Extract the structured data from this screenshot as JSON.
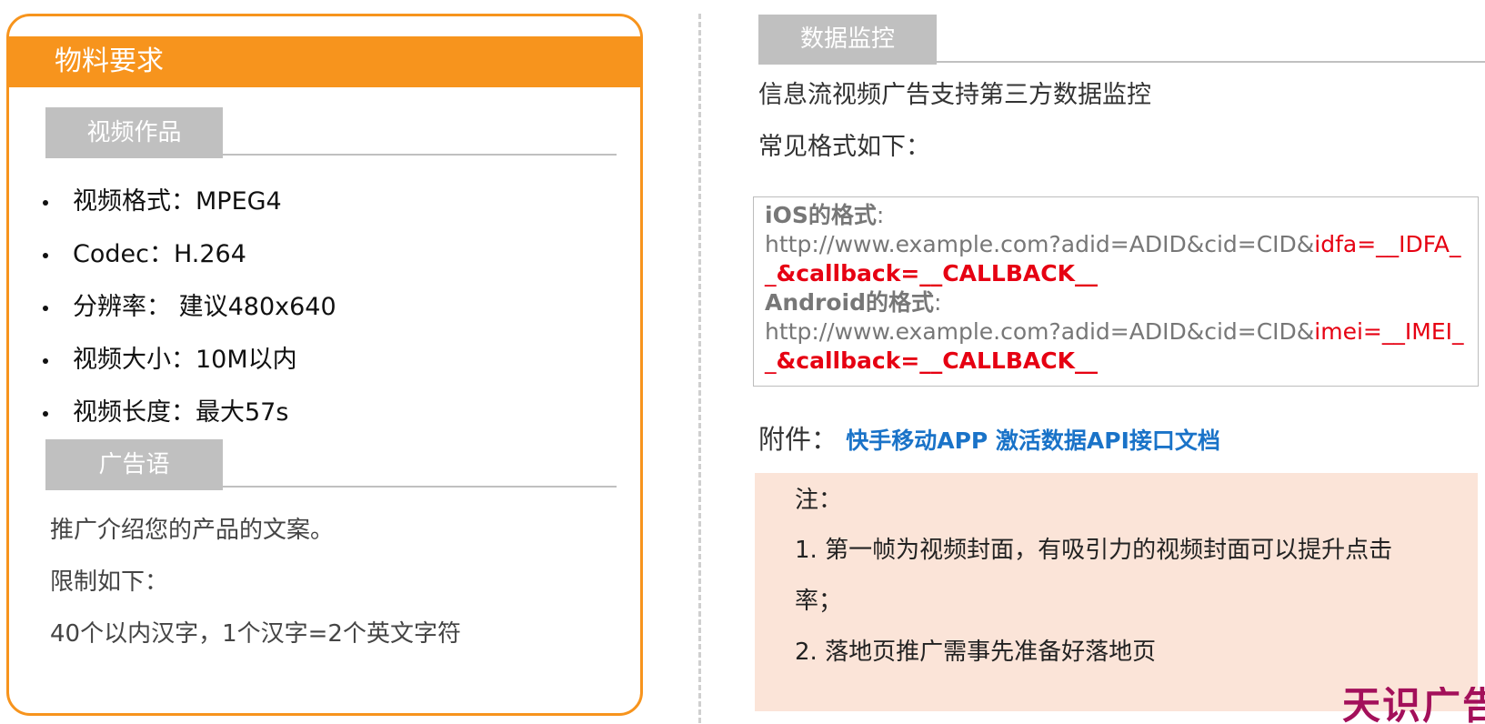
{
  "left_panel": {
    "header_title": "物料要求",
    "video_section": {
      "tab_label": "视频作品",
      "specs": [
        "视频格式：MPEG4",
        "Codec：H.264",
        "分辨率： 建议480x640",
        "视频大小：10M以内",
        "视频长度：最大57s"
      ]
    },
    "slogan_section": {
      "tab_label": "广告语",
      "lines": [
        "推广介绍您的产品的文案。",
        "限制如下：",
        "40个以内汉字，1个汉字=2个英文字符"
      ]
    }
  },
  "right_panel": {
    "tab_label": "数据监控",
    "intro_lines": [
      "信息流视频广告支持第三方数据监控",
      "常见格式如下："
    ],
    "formats": {
      "ios_label": "iOS的格式",
      "ios_url_base": "http://www.example.com?adid=ADID&cid=CID&",
      "ios_param": "idfa=__IDFA__",
      "ios_callback": "&callback=__CALLBACK__",
      "android_label": "Android的格式",
      "android_url_base": "http://www.example.com?adid=ADID&cid=CID&",
      "android_param": "imei=__IMEI__",
      "android_callback": "&callback=__CALLBACK__",
      "colon": ":"
    },
    "attachment": {
      "label": "附件：",
      "link_text": "快手移动APP 激活数据API接口文档"
    },
    "notes": {
      "title": "注：",
      "lines": [
        "1. 第一帧为视频封面，有吸引力的视频封面可以提升点击",
        "率；",
        "2. 落地页推广需事先准备好落地页"
      ]
    }
  },
  "watermark": "天识广告",
  "colors": {
    "accent_orange": "#f7941d",
    "tab_gray": "#c0c0c0",
    "highlight_red": "#e60012",
    "link_blue": "#1a73c8",
    "note_bg": "#fbe4d8",
    "watermark": "#a3105a"
  }
}
